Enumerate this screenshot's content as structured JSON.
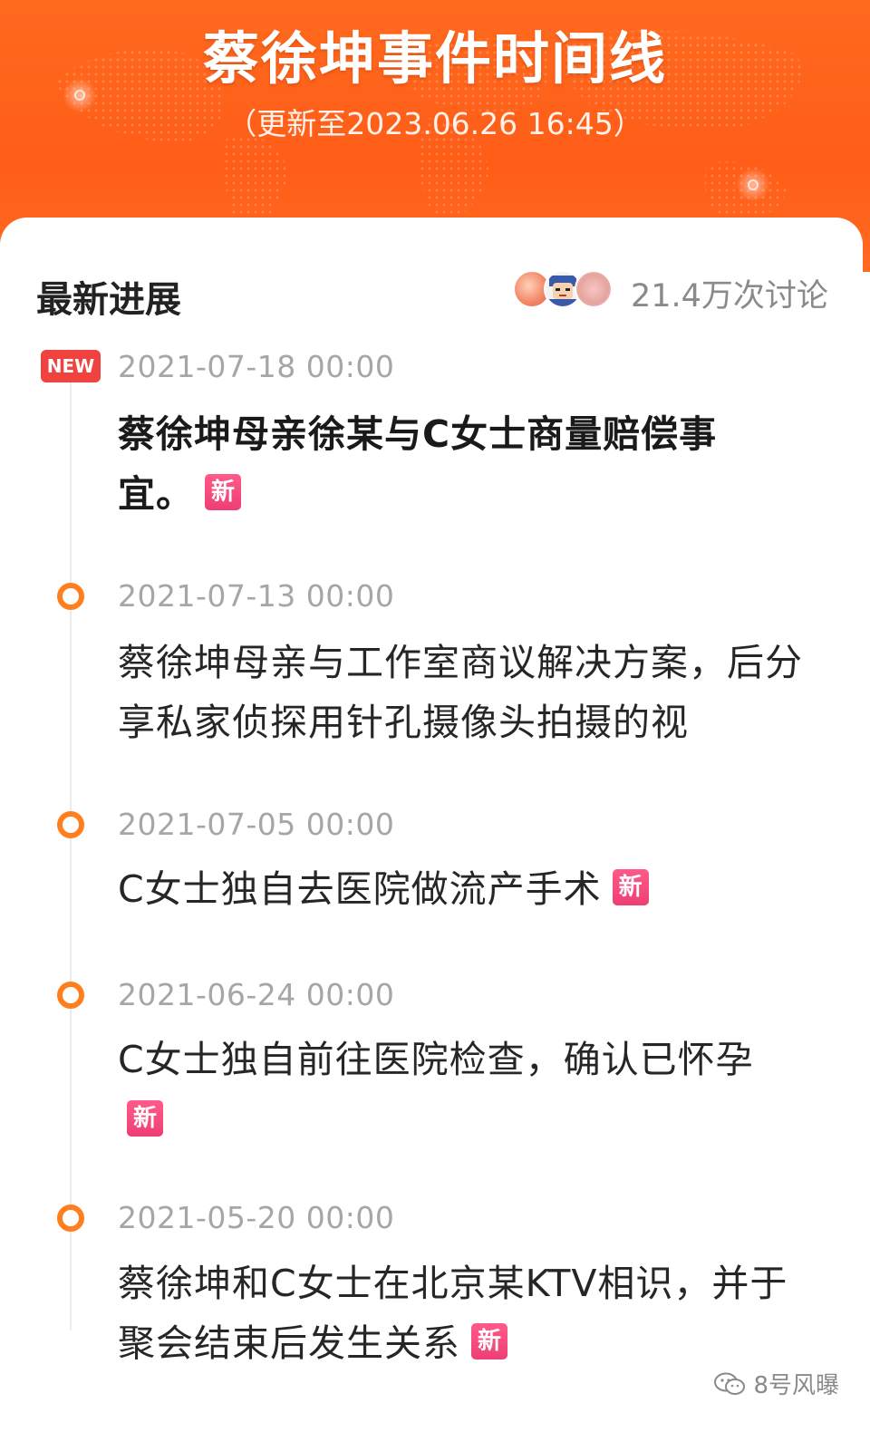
{
  "header": {
    "title": "蔡徐坤事件时间线",
    "subtitle": "（更新至2023.06.26 16:45）",
    "accent_color": "#ff6a1f"
  },
  "card": {
    "section_title": "最新进展",
    "discussion_count": "21.4万次讨论",
    "avatars": [
      "peach-avatar",
      "cartoon-avatar",
      "pink-avatar"
    ]
  },
  "timeline": [
    {
      "badge": "NEW",
      "date": "2021-07-18 00:00",
      "text": "蔡徐坤母亲徐某与C女士商量赔偿事宜。",
      "tag": "新",
      "bold": true
    },
    {
      "date": "2021-07-13 00:00",
      "text": "蔡徐坤母亲与工作室商议解决方案，后分享私家侦探用针孔摄像头拍摄的视"
    },
    {
      "date": "2021-07-05 00:00",
      "text": "C女士独自去医院做流产手术",
      "tag": "新"
    },
    {
      "date": "2021-06-24 00:00",
      "text": "C女士独自前往医院检查，确认已怀孕",
      "tag": "新"
    },
    {
      "date": "2021-05-20 00:00",
      "text": "蔡徐坤和C女士在北京某KTV相识，并于聚会结束后发生关系",
      "tag": "新"
    }
  ],
  "watermark": {
    "label": "8号风曝",
    "icon": "wechat-icon"
  },
  "colors": {
    "dot_orange": "#ff7f1f",
    "new_badge_red": "#f0433f",
    "tag_pink": "#ee3f74",
    "date_gray": "#a6a6a6"
  }
}
